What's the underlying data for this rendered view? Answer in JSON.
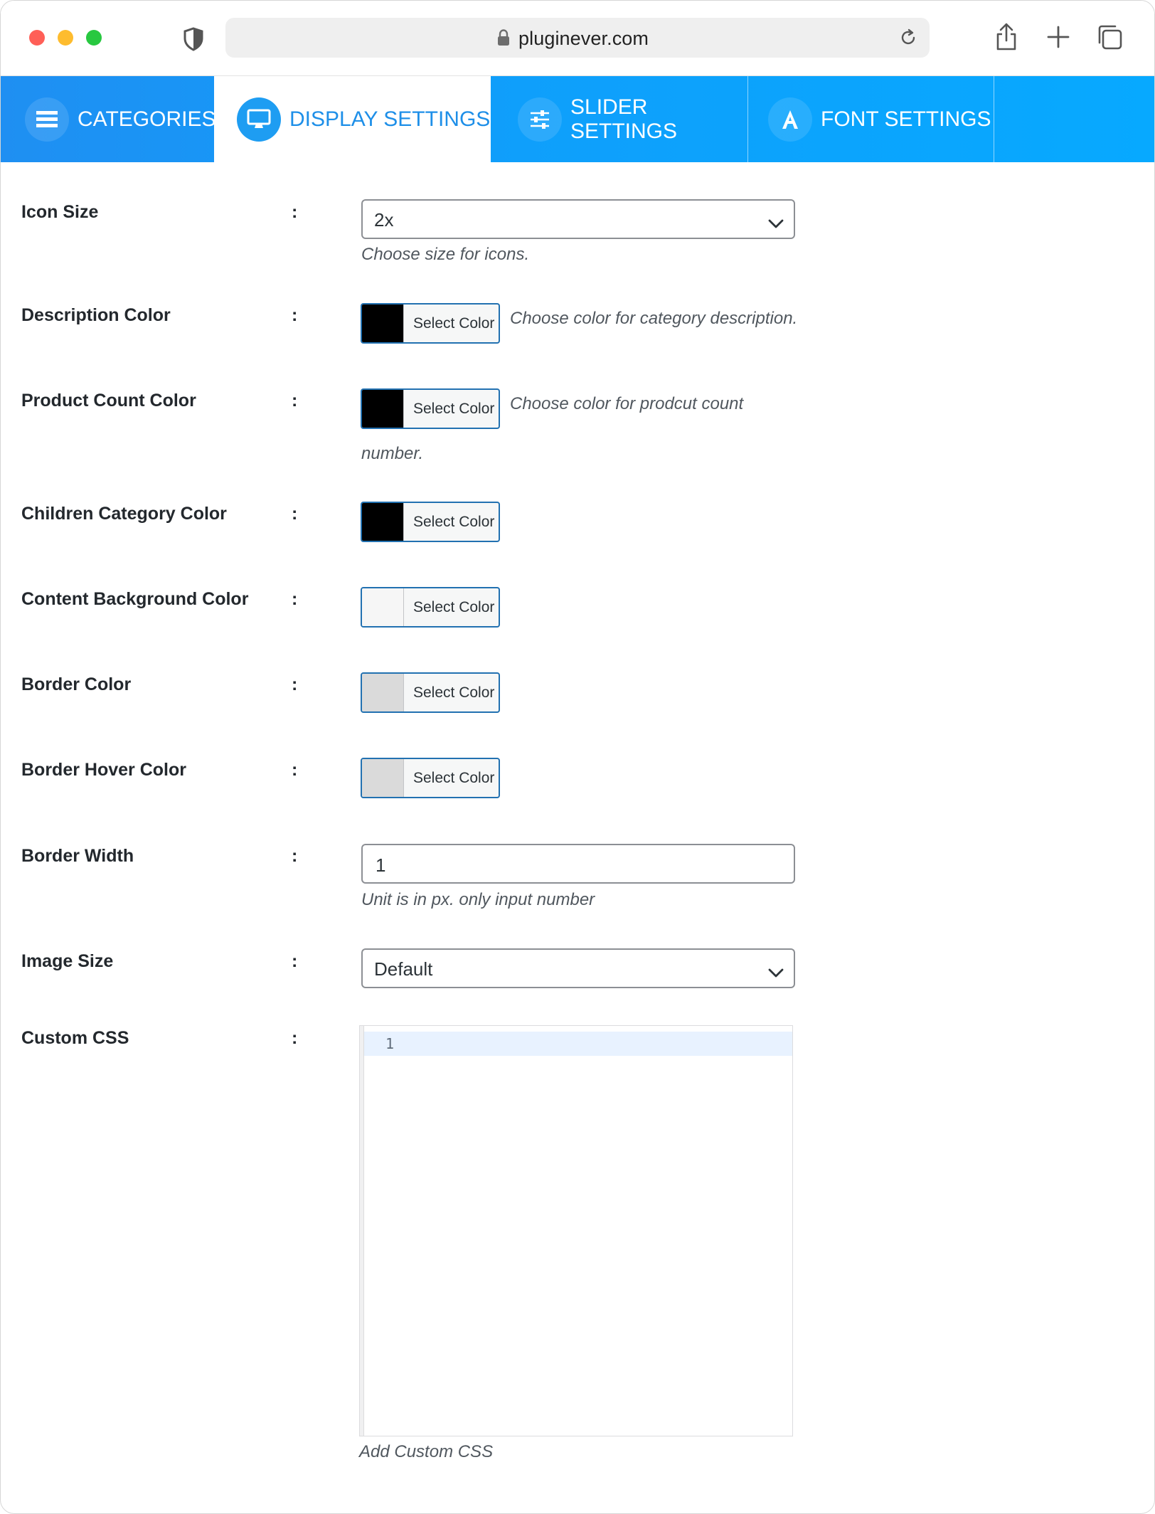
{
  "browser": {
    "url": "pluginever.com"
  },
  "tabs": [
    {
      "label": "CATEGORIES",
      "icon": "list-icon",
      "active": false
    },
    {
      "label": "DISPLAY SETTINGS",
      "icon": "monitor-icon",
      "active": true
    },
    {
      "label": "SLIDER SETTINGS",
      "icon": "sliders-icon",
      "active": false
    },
    {
      "label": "FONT SETTINGS",
      "icon": "font-icon",
      "active": false
    }
  ],
  "colon": ":",
  "fields": {
    "icon_size": {
      "label": "Icon Size",
      "value": "2x",
      "help": "Choose size for icons."
    },
    "description_color": {
      "label": "Description Color",
      "button": "Select Color",
      "swatch": "#000000",
      "help": "Choose color for category description."
    },
    "product_count_color": {
      "label": "Product Count Color",
      "button": "Select Color",
      "swatch": "#000000",
      "help_line1": "Choose color for prodcut count",
      "help_line2": "number."
    },
    "children_category_color": {
      "label": "Children Category Color",
      "button": "Select Color",
      "swatch": "#000000"
    },
    "content_background_color": {
      "label": "Content Background Color",
      "button": "Select Color",
      "swatch": "#f6f6f6"
    },
    "border_color": {
      "label": "Border Color",
      "button": "Select Color",
      "swatch": "#dadada"
    },
    "border_hover_color": {
      "label": "Border Hover Color",
      "button": "Select Color",
      "swatch": "#dadada"
    },
    "border_width": {
      "label": "Border Width",
      "value": "1",
      "help": "Unit is in px. only input number"
    },
    "image_size": {
      "label": "Image Size",
      "value": "Default"
    },
    "custom_css": {
      "label": "Custom CSS",
      "line_number": "1",
      "help": "Add Custom CSS"
    }
  },
  "colors": {
    "accent": "#1e8fe8",
    "button_border": "#2271b1"
  }
}
